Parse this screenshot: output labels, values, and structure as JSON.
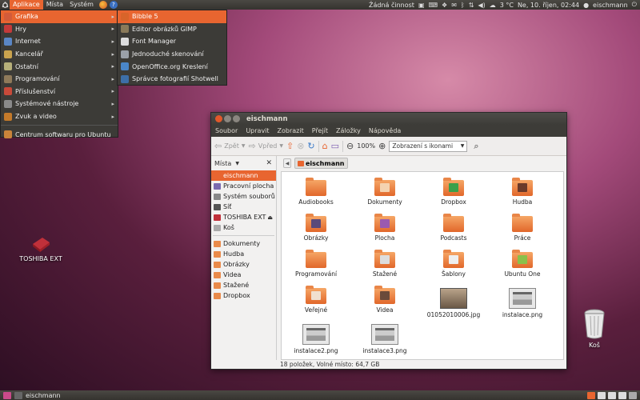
{
  "top_panel": {
    "menus": [
      "Aplikace",
      "Místa",
      "Systém"
    ],
    "status_text": "Žádná činnost",
    "weather": "3 °C",
    "clock": "Ne, 10. říjen, 02:44",
    "user": "eischmann"
  },
  "apps_menu": {
    "items": [
      {
        "label": "Grafika",
        "icon": "graphics-icon",
        "color": "#d35b3a"
      },
      {
        "label": "Hry",
        "icon": "games-icon",
        "color": "#c43a3a"
      },
      {
        "label": "Internet",
        "icon": "internet-icon",
        "color": "#5a86c5"
      },
      {
        "label": "Kancelář",
        "icon": "office-icon",
        "color": "#c9a34e"
      },
      {
        "label": "Ostatní",
        "icon": "other-icon",
        "color": "#b7b07a"
      },
      {
        "label": "Programování",
        "icon": "programming-icon",
        "color": "#8f7a5a"
      },
      {
        "label": "Příslušenství",
        "icon": "accessories-icon",
        "color": "#c84a3a"
      },
      {
        "label": "Systémové nástroje",
        "icon": "system-tools-icon",
        "color": "#8a8a8a"
      },
      {
        "label": "Zvuk a video",
        "icon": "sound-video-icon",
        "color": "#c47a2a"
      }
    ],
    "footer_item": {
      "label": "Centrum softwaru pro Ubuntu",
      "icon": "software-center-icon",
      "color": "#c9843a"
    }
  },
  "graphics_submenu": {
    "items": [
      {
        "label": "Bibble 5",
        "icon": "bibble-icon",
        "color": "#d8642a"
      },
      {
        "label": "Editor obrázků GIMP",
        "icon": "gimp-icon",
        "color": "#8a7a5a"
      },
      {
        "label": "Font Manager",
        "icon": "font-manager-icon",
        "color": "#dddddd"
      },
      {
        "label": "Jednoduché skenování",
        "icon": "scanner-icon",
        "color": "#9aa0a8"
      },
      {
        "label": "OpenOffice.org Kreslení",
        "icon": "draw-icon",
        "color": "#4a86c8"
      },
      {
        "label": "Správce fotografií Shotwell",
        "icon": "shotwell-icon",
        "color": "#3d6fa8"
      }
    ]
  },
  "desktop": {
    "icons": [
      {
        "label": "TOSHIBA EXT",
        "icon": "external-drive-icon"
      },
      {
        "label": "Koš",
        "icon": "trash-icon"
      }
    ]
  },
  "file_manager": {
    "title": "eischmann",
    "menubar": [
      "Soubor",
      "Upravit",
      "Zobrazit",
      "Přejít",
      "Záložky",
      "Nápověda"
    ],
    "toolbar": {
      "back": "Zpět",
      "forward": "Vpřed",
      "zoom": "100%",
      "view_mode": "Zobrazení s ikonami"
    },
    "sidebar": {
      "header": "Místa",
      "places": [
        {
          "label": "eischmann",
          "icon": "home-icon",
          "color": "#e86530"
        },
        {
          "label": "Pracovní plocha",
          "icon": "desktop-icon",
          "color": "#7a6ab0"
        },
        {
          "label": "Systém souborů",
          "icon": "filesystem-icon",
          "color": "#888888"
        },
        {
          "label": "Síť",
          "icon": "network-icon",
          "color": "#555555"
        },
        {
          "label": "TOSHIBA EXT",
          "icon": "external-drive-icon",
          "color": "#c0303a",
          "eject": true
        },
        {
          "label": "Koš",
          "icon": "trash-icon",
          "color": "#aaaaaa"
        }
      ],
      "bookmarks": [
        {
          "label": "Dokumenty",
          "icon": "documents-folder-icon",
          "color": "#e98a4a"
        },
        {
          "label": "Hudba",
          "icon": "music-folder-icon",
          "color": "#e98a4a"
        },
        {
          "label": "Obrázky",
          "icon": "pictures-folder-icon",
          "color": "#e98a4a"
        },
        {
          "label": "Videa",
          "icon": "videos-folder-icon",
          "color": "#e98a4a"
        },
        {
          "label": "Stažené",
          "icon": "downloads-folder-icon",
          "color": "#e98a4a"
        },
        {
          "label": "Dropbox",
          "icon": "dropbox-folder-icon",
          "color": "#e98a4a"
        }
      ]
    },
    "path": "eischmann",
    "files": [
      {
        "label": "Audiobooks",
        "kind": "folder",
        "emblem": ""
      },
      {
        "label": "Dokumenty",
        "kind": "folder",
        "emblem": "#f4d3b0"
      },
      {
        "label": "Dropbox",
        "kind": "folder",
        "emblem": "#3aa04a"
      },
      {
        "label": "Hudba",
        "kind": "folder",
        "emblem": "#6a3a2a"
      },
      {
        "label": "Obrázky",
        "kind": "folder",
        "emblem": "#5a4a7a"
      },
      {
        "label": "Plocha",
        "kind": "folder",
        "emblem": "#9a5ab0"
      },
      {
        "label": "Podcasts",
        "kind": "folder",
        "emblem": ""
      },
      {
        "label": "Práce",
        "kind": "folder",
        "emblem": ""
      },
      {
        "label": "Programování",
        "kind": "folder",
        "emblem": ""
      },
      {
        "label": "Stažené",
        "kind": "folder",
        "emblem": "#dddddd"
      },
      {
        "label": "Šablony",
        "kind": "folder",
        "emblem": "#eeeeee"
      },
      {
        "label": "Ubuntu One",
        "kind": "folder",
        "emblem": "#8ac04a"
      },
      {
        "label": "Veřejné",
        "kind": "folder",
        "emblem": "#f0e0d0"
      },
      {
        "label": "Videa",
        "kind": "folder",
        "emblem": "#6a4a3a"
      },
      {
        "label": "01052010006.jpg",
        "kind": "photo",
        "emblem": ""
      },
      {
        "label": "instalace.png",
        "kind": "screenshot",
        "emblem": ""
      },
      {
        "label": "instalace2.png",
        "kind": "screenshot",
        "emblem": ""
      },
      {
        "label": "instalace3.png",
        "kind": "screenshot",
        "emblem": ""
      }
    ],
    "status": "18 položek, Volné místo: 64,7 GB"
  },
  "bottom_panel": {
    "task": "eischmann"
  }
}
